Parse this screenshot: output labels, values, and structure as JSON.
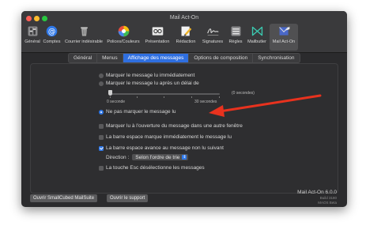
{
  "window": {
    "title": "Mail Act-On"
  },
  "toolbar": {
    "items": [
      {
        "label": "Général",
        "icon": "switch-icon"
      },
      {
        "label": "Comptes",
        "icon": "at-sign-icon"
      },
      {
        "label": "Courrier indésirable",
        "icon": "trash-bin-icon"
      },
      {
        "label": "Polices/Couleurs",
        "icon": "color-wheel-icon"
      },
      {
        "label": "Présentation",
        "icon": "glasses-icon"
      },
      {
        "label": "Rédaction",
        "icon": "pencil-icon"
      },
      {
        "label": "Signatures",
        "icon": "signature-icon"
      },
      {
        "label": "Règles",
        "icon": "rules-icon"
      },
      {
        "label": "Mailbutler",
        "icon": "mailbutler-icon"
      },
      {
        "label": "Mail Act-On",
        "icon": "mail-act-on-icon"
      }
    ],
    "active_index": 9
  },
  "tabs": [
    {
      "label": "Général",
      "active": false
    },
    {
      "label": "Menus",
      "active": false
    },
    {
      "label": "Affichage des messages",
      "active": true
    },
    {
      "label": "Options de composition",
      "active": false
    },
    {
      "label": "Synchronisation",
      "active": false
    }
  ],
  "options": {
    "mark_immediately": {
      "label": "Marquer le message lu immédiatement",
      "checked": false
    },
    "mark_after_delay": {
      "label": "Marquer le message lu après un délai de",
      "checked": false
    },
    "delay_value": "(0 secondes)",
    "slider_min": "0 seconde",
    "slider_max": "30 secondes",
    "slider_value": 0,
    "do_not_mark": {
      "label": "Ne pas marquer le message lu",
      "checked": true
    },
    "mark_on_open": {
      "label": "Marquer lu à l'ouverture du message dans une autre fenêtre",
      "checked": false
    },
    "space_marks": {
      "label": "La barre espace marque immédiatement le message lu",
      "checked": false
    },
    "space_advances": {
      "label": "La barre espace avance au message non lu suivant",
      "checked": true
    },
    "direction_label": "Direction :",
    "direction_value": "Selon l'ordre de trie",
    "esc_deselects": {
      "label": "La touche Esc désélectionne les messages",
      "checked": false
    }
  },
  "footer": {
    "open_suite": "Ouvrir SmallCubed MailSuite",
    "open_support": "Ouvrir le support",
    "product": "Mail Act-On 6.0.0",
    "build": "Build 3180",
    "license": "MAOS Beta"
  },
  "colors": {
    "accent": "#2f78e8",
    "arrow": "#e8321e"
  }
}
